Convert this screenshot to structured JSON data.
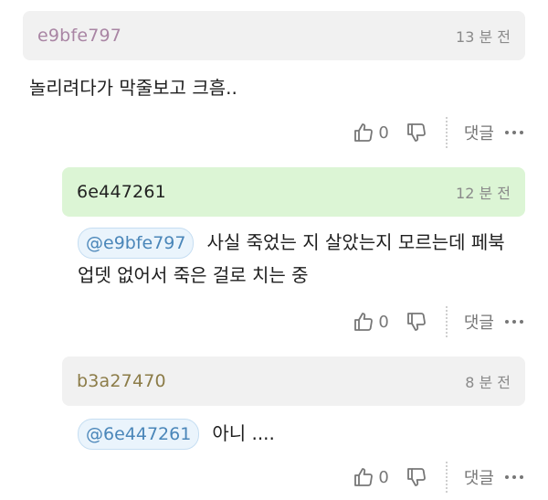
{
  "comments": [
    {
      "author": "e9bfe797",
      "time": "13 분 전",
      "mention": "",
      "text": "놀리려다가 막줄보고 크흠..",
      "likes": "0",
      "reply_label": "댓글"
    },
    {
      "author": "6e447261",
      "time": "12 분 전",
      "mention": "@e9bfe797",
      "text": "사실 죽었는 지 살았는지 모르는데 페북 업뎃 없어서 죽은 걸로 치는 중",
      "likes": "0",
      "reply_label": "댓글"
    },
    {
      "author": "b3a27470",
      "time": "8 분 전",
      "mention": "@6e447261",
      "text": "아니 ....",
      "likes": "0",
      "reply_label": "댓글"
    }
  ],
  "icons": {
    "like": "thumbs-up-icon",
    "dislike": "thumbs-down-icon",
    "more": "more-dots-icon"
  },
  "colors": {
    "reply_header": "#dcf5d5",
    "default_header": "#f1f1f1",
    "mention_text": "#4a86b9"
  }
}
